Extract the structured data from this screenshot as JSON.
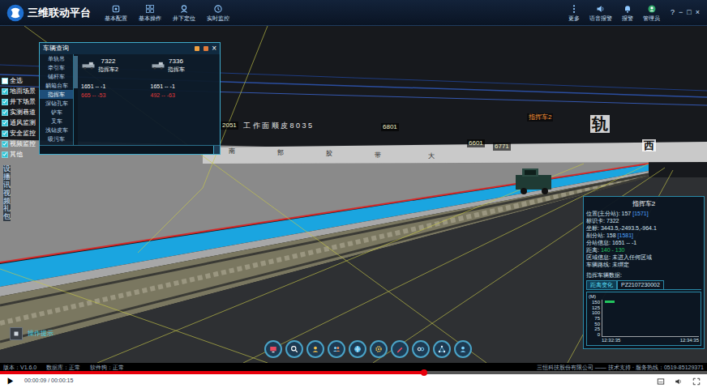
{
  "window": {
    "title": "三维联动平台",
    "controls": [
      "?",
      "−",
      "□",
      "×"
    ]
  },
  "nav": [
    {
      "label": "基本配置"
    },
    {
      "label": "基本操作"
    },
    {
      "label": "井下定位"
    },
    {
      "label": "实时监控"
    }
  ],
  "toolbar": [
    {
      "label": "更多"
    },
    {
      "label": "语音报警"
    },
    {
      "label": "报警"
    },
    {
      "label": "管理员"
    }
  ],
  "layers": [
    {
      "label": "全选",
      "checked": false
    },
    {
      "label": "地面场景",
      "checked": true
    },
    {
      "label": "井下场景",
      "checked": true
    },
    {
      "label": "实测巷道",
      "checked": true
    },
    {
      "label": "通风监测",
      "checked": true
    },
    {
      "label": "安全监控",
      "checked": true
    },
    {
      "label": "视频监控",
      "checked": true
    },
    {
      "label": "其他",
      "checked": true
    }
  ],
  "side_tab": "设播讯视频礼包",
  "vehicle_panel": {
    "title": "车辆查询",
    "close": "×",
    "types": [
      {
        "label": "单轨吊",
        "selected": false
      },
      {
        "label": "牵引车",
        "selected": false
      },
      {
        "label": "铺杆车",
        "selected": false
      },
      {
        "label": "躺箱台车",
        "selected": false
      },
      {
        "label": "指挥车",
        "selected": true
      },
      {
        "label": "深钻孔车",
        "selected": false
      },
      {
        "label": "铲车",
        "selected": false
      },
      {
        "label": "叉车",
        "selected": false
      },
      {
        "label": "浅钻皮车",
        "selected": false
      },
      {
        "label": "吸污车",
        "selected": false
      }
    ],
    "cards": [
      {
        "id": "7322",
        "name": "指挥车2",
        "station": "1651 -- -1",
        "range": "665 -- -53"
      },
      {
        "id": "7336",
        "name": "指挥车",
        "station": "1651 -- -1",
        "range": "492 -- -63"
      }
    ]
  },
  "scene_labels": [
    {
      "text": "2051",
      "kind": "station"
    },
    {
      "text": "工 作 面 顺 皮 8 0 3 5",
      "kind": "tunnel"
    },
    {
      "text": "6801",
      "kind": "station"
    },
    {
      "text": "6601",
      "kind": "station"
    },
    {
      "text": "6771",
      "kind": "station"
    },
    {
      "text": "指挥车2",
      "kind": "vehicle"
    },
    {
      "text": "轨",
      "kind": "big"
    },
    {
      "text": "西",
      "kind": "big"
    },
    {
      "text": "南",
      "kind": "ground"
    },
    {
      "text": "部",
      "kind": "ground"
    },
    {
      "text": "胶",
      "kind": "ground"
    },
    {
      "text": "带",
      "kind": "ground"
    },
    {
      "text": "大",
      "kind": "ground"
    }
  ],
  "info": {
    "title": "指挥车2",
    "fields": [
      {
        "label": "位置(主分站): ",
        "value": "157",
        "extra": "[1571]",
        "alert": false
      },
      {
        "label": "标识卡: ",
        "value": "7322",
        "extra": "",
        "alert": false
      },
      {
        "label": "坐标: ",
        "value": "3443.5,-2493.5,-964.1",
        "extra": "",
        "alert": false
      },
      {
        "label": "副分站: ",
        "value": "158",
        "extra": "[1581]",
        "alert": false
      },
      {
        "label": "分站信息: ",
        "value": "1651 -- -1",
        "extra": "",
        "alert": false
      },
      {
        "label": "距离: ",
        "value": "140 - 130",
        "extra": "",
        "alert": true
      },
      {
        "label": "区域信息: ",
        "value": "未进入任何区域",
        "extra": "",
        "alert": false
      },
      {
        "label": "车辆路线: ",
        "value": "未绑定",
        "extra": "",
        "alert": false
      }
    ],
    "section": "指挥车辆数据:",
    "tabs": [
      {
        "label": "距离变化",
        "selected": true
      },
      {
        "label": "PZ2107230002",
        "selected": false
      }
    ],
    "chart": {
      "unit": "(M)",
      "ticks": [
        "150",
        "125",
        "100",
        "75",
        "50",
        "25",
        "0"
      ],
      "series": [
        {
          "name": "距离",
          "values": [
            140
          ],
          "color": "#22c55e"
        }
      ],
      "x_labels": [
        "12:32:35",
        "12:34:35"
      ]
    }
  },
  "hint": "操作提示",
  "status": {
    "items": [
      "版本：V1.6.0",
      "数据库：正常",
      "软件狗：正常"
    ],
    "company": "三恒科技股份有限公司 —— 技术支持 · 服务热线：0519-85129371"
  },
  "player": {
    "play": "▶",
    "time": "00:00:09 / 00:00:15",
    "level": 0.6
  }
}
